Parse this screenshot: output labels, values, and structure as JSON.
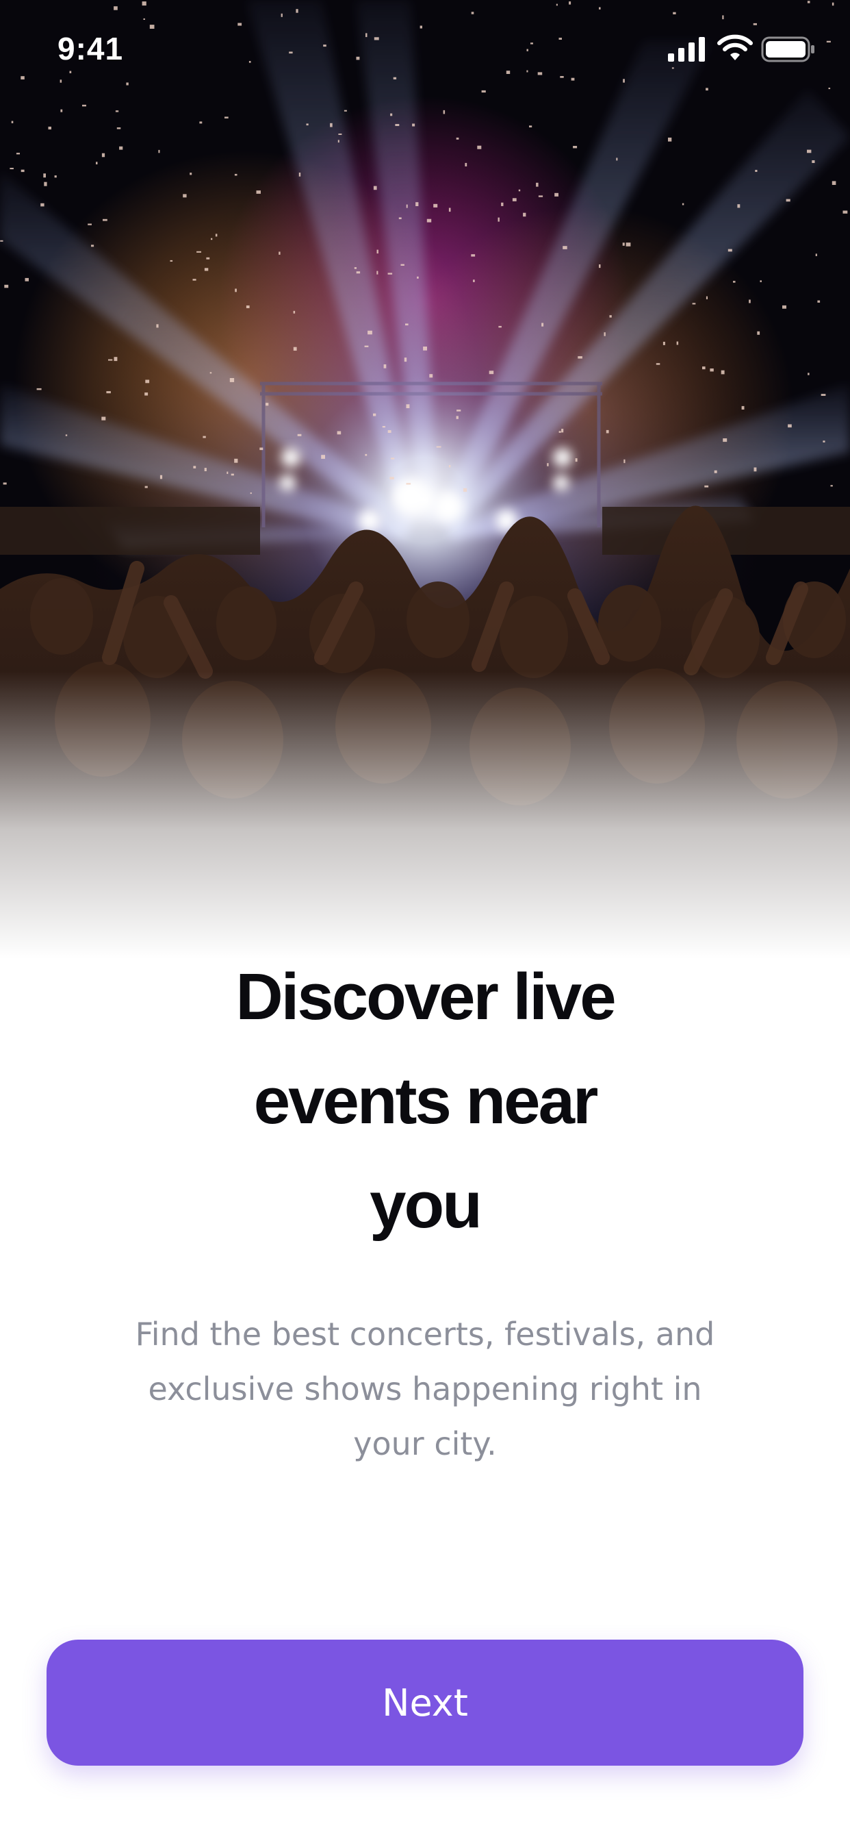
{
  "status_bar": {
    "time": "9:41",
    "signal_icon": "cellular-signal-icon",
    "wifi_icon": "wifi-icon",
    "battery_icon": "battery-icon"
  },
  "hero": {
    "image_subject": "concert-crowd-stage-lights"
  },
  "onboarding": {
    "headline": "Discover live events near you",
    "subtitle": "Find the best concerts, festivals, and exclusive shows happening right in your city."
  },
  "actions": {
    "next_label": "Next"
  },
  "colors": {
    "accent": "#7b55e2",
    "headline": "#0b0b0f",
    "subtitle": "#8c8f9a",
    "background": "#ffffff"
  }
}
